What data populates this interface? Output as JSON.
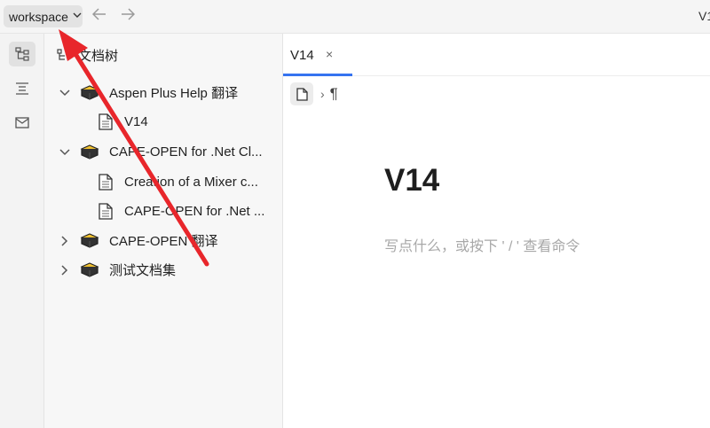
{
  "topbar": {
    "workspace_label": "workspace",
    "back_icon": "arrow-left-icon",
    "forward_icon": "arrow-right-icon",
    "right_text": "V1"
  },
  "rail": {
    "items": [
      {
        "icon": "file-tree-icon",
        "active": true
      },
      {
        "icon": "outline-icon",
        "active": false
      },
      {
        "icon": "inbox-icon",
        "active": false
      }
    ]
  },
  "sidebar": {
    "title": "文档树",
    "tree": [
      {
        "label": "Aspen Plus Help 翻译",
        "type": "notebook",
        "expanded": true
      },
      {
        "label": "V14",
        "type": "doc"
      },
      {
        "label": "CAPE-OPEN for .Net Cl...",
        "type": "notebook",
        "expanded": true
      },
      {
        "label": "Creation of a Mixer c...",
        "type": "doc"
      },
      {
        "label": "CAPE-OPEN for .Net ...",
        "type": "doc"
      },
      {
        "label": "CAPE-OPEN 翻译",
        "type": "notebook",
        "expanded": false
      },
      {
        "label": "测试文档集",
        "type": "notebook",
        "expanded": false
      }
    ]
  },
  "editor": {
    "tab_label": "V14",
    "tab_close": "×",
    "breadcrumb_sep": "›",
    "breadcrumb_para": "¶",
    "doc_title": "V14",
    "placeholder": "写点什么，或按下 ' / ' 查看命令"
  },
  "colors": {
    "accent": "#3573f0",
    "annotation": "#e8262b"
  }
}
